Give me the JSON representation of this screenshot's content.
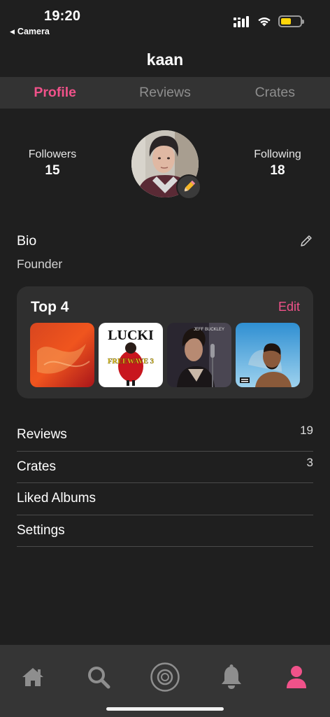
{
  "status_bar": {
    "time": "19:20",
    "back_app": "Camera",
    "icons": [
      "cellular-signal-icon",
      "wifi-icon",
      "battery-icon"
    ],
    "battery_level": 0.55,
    "battery_color": "#ffd60a"
  },
  "header": {
    "title": "kaan"
  },
  "tabs": [
    {
      "label": "Profile",
      "active": true
    },
    {
      "label": "Reviews",
      "active": false
    },
    {
      "label": "Crates",
      "active": false
    }
  ],
  "stats": {
    "followers_label": "Followers",
    "followers_count": "15",
    "following_label": "Following",
    "following_count": "18"
  },
  "bio": {
    "title": "Bio",
    "text": "Founder"
  },
  "top4": {
    "title": "Top 4",
    "edit_label": "Edit",
    "albums": [
      {
        "cover": "red-abstract-cover"
      },
      {
        "cover": "lucki-freewave-3-cover",
        "text": "LUCKI",
        "subtext": "FREEWAVE 3"
      },
      {
        "cover": "jeff-buckley-grace-cover",
        "text": "JEFF BUCKLEY"
      },
      {
        "cover": "drake-nothing-was-the-same-cover"
      }
    ]
  },
  "menu": [
    {
      "label": "Reviews",
      "count": "19"
    },
    {
      "label": "Crates",
      "count": "3"
    },
    {
      "label": "Liked Albums",
      "count": ""
    },
    {
      "label": "Settings",
      "count": ""
    }
  ],
  "tabbar": {
    "items": [
      "home-icon",
      "search-icon",
      "vinyl-record-icon",
      "bell-icon",
      "profile-icon"
    ],
    "active_index": 4
  },
  "colors": {
    "accent": "#f0528a",
    "background": "#1f1f1f",
    "card": "#2f2f2f",
    "tab_strip": "#333333"
  }
}
